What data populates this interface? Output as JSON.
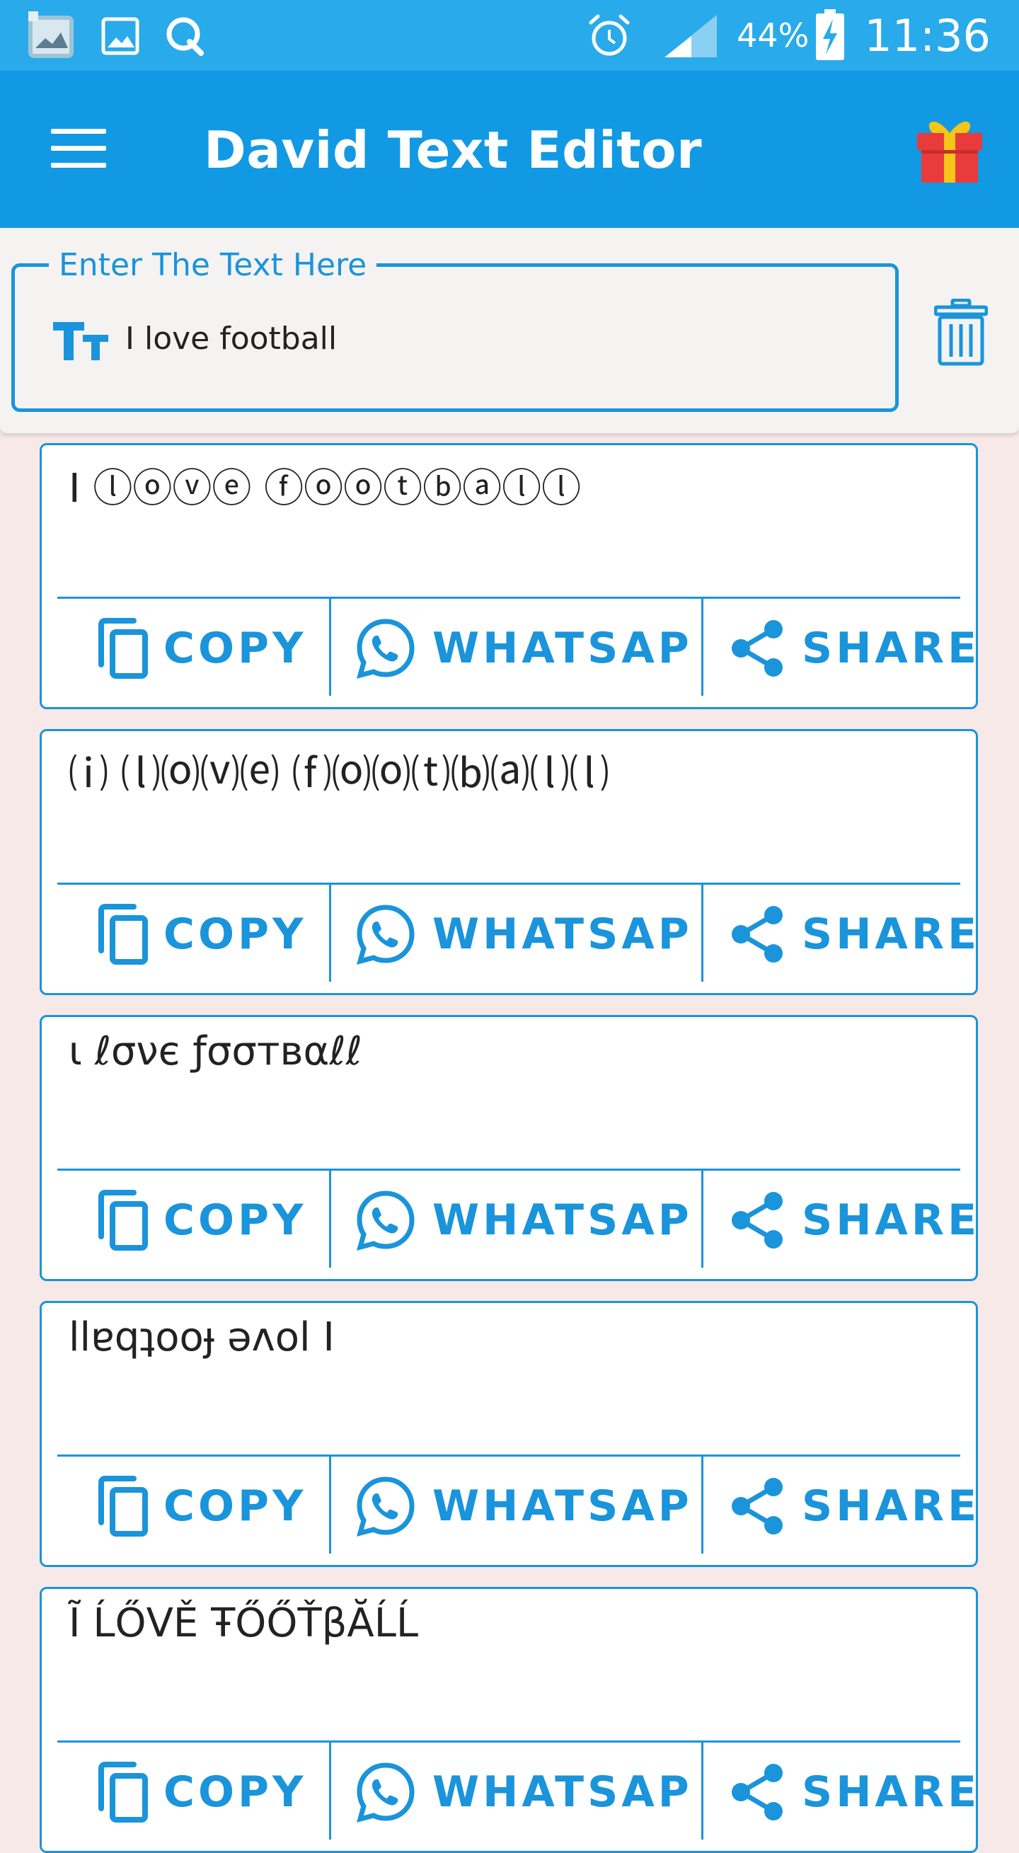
{
  "status_bar": {
    "battery": "44%",
    "time": "11:36",
    "icons": [
      "gallery-thumbnail-icon",
      "image-icon",
      "q-app-icon",
      "alarm-icon",
      "signal-icon",
      "battery-charging-icon"
    ]
  },
  "app_bar": {
    "title": "David Text Editor",
    "menu_icon": "hamburger-menu-icon",
    "gift_icon": "gift-icon"
  },
  "input": {
    "label": "Enter The Text Here",
    "value": "I love football",
    "icons": [
      "text-size-icon",
      "trash-icon"
    ]
  },
  "colors": {
    "status_bar": "#29aaea",
    "app_bar": "#1299e3",
    "accent": "#1a94db",
    "background": "#f7e9e7",
    "gift_red": "#e93b3b",
    "gift_yellow": "#f5c518"
  },
  "results": [
    {
      "text": "I ⓛⓞⓥⓔ ⓕⓞⓞⓣⓑⓐⓛⓛ",
      "copy": "COPY",
      "whatsapp": "WHATSAP",
      "share": "SHARE"
    },
    {
      "text": "⒤ ⒧⒪⒱⒠ ⒡⒪⒪⒯⒝⒜⒧⒧",
      "copy": "COPY",
      "whatsapp": "WHATSAP",
      "share": "SHARE"
    },
    {
      "text": "ι ℓσνє ƒσσтвαℓℓ",
      "copy": "COPY",
      "whatsapp": "WHATSAP",
      "share": "SHARE"
    },
    {
      "text": "llɐqʇooɟ ǝʌol I",
      "copy": "COPY",
      "whatsapp": "WHATSAP",
      "share": "SHARE"
    },
    {
      "text": "Ĩ ĹŐVĚ ŦŐŐŤβĂĹĹ",
      "copy": "COPY",
      "whatsapp": "WHATSAP",
      "share": "SHARE"
    }
  ]
}
